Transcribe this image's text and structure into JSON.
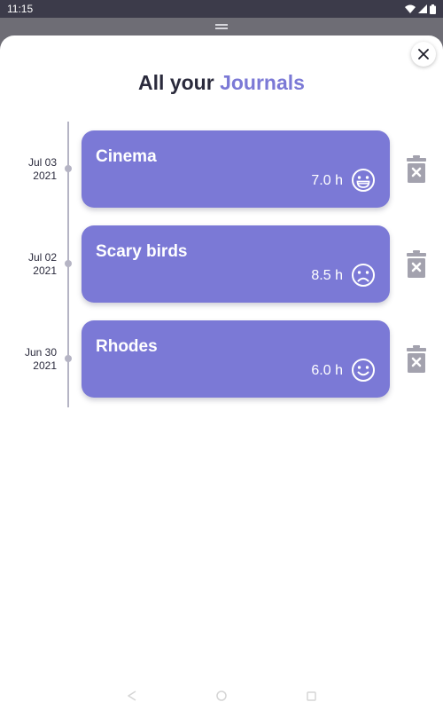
{
  "status_bar": {
    "time": "11:15"
  },
  "header": {
    "title_prefix": "All your",
    "title_accent": "Journals"
  },
  "colors": {
    "accent": "#7b79d6",
    "card": "#7b79d6",
    "title_text": "#2a2a3c",
    "timeline": "#b5b4c4",
    "delete_icon": "#a3a2ae"
  },
  "journals": [
    {
      "date_line1": "Jul 03",
      "date_line2": "2021",
      "title": "Cinema",
      "hours": "7.0 h",
      "mood_icon": "grinning-face-icon"
    },
    {
      "date_line1": "Jul 02",
      "date_line2": "2021",
      "title": "Scary birds",
      "hours": "8.5 h",
      "mood_icon": "sad-face-icon"
    },
    {
      "date_line1": "Jun 30",
      "date_line2": "2021",
      "title": "Rhodes",
      "hours": "6.0 h",
      "mood_icon": "smiling-face-icon"
    }
  ]
}
